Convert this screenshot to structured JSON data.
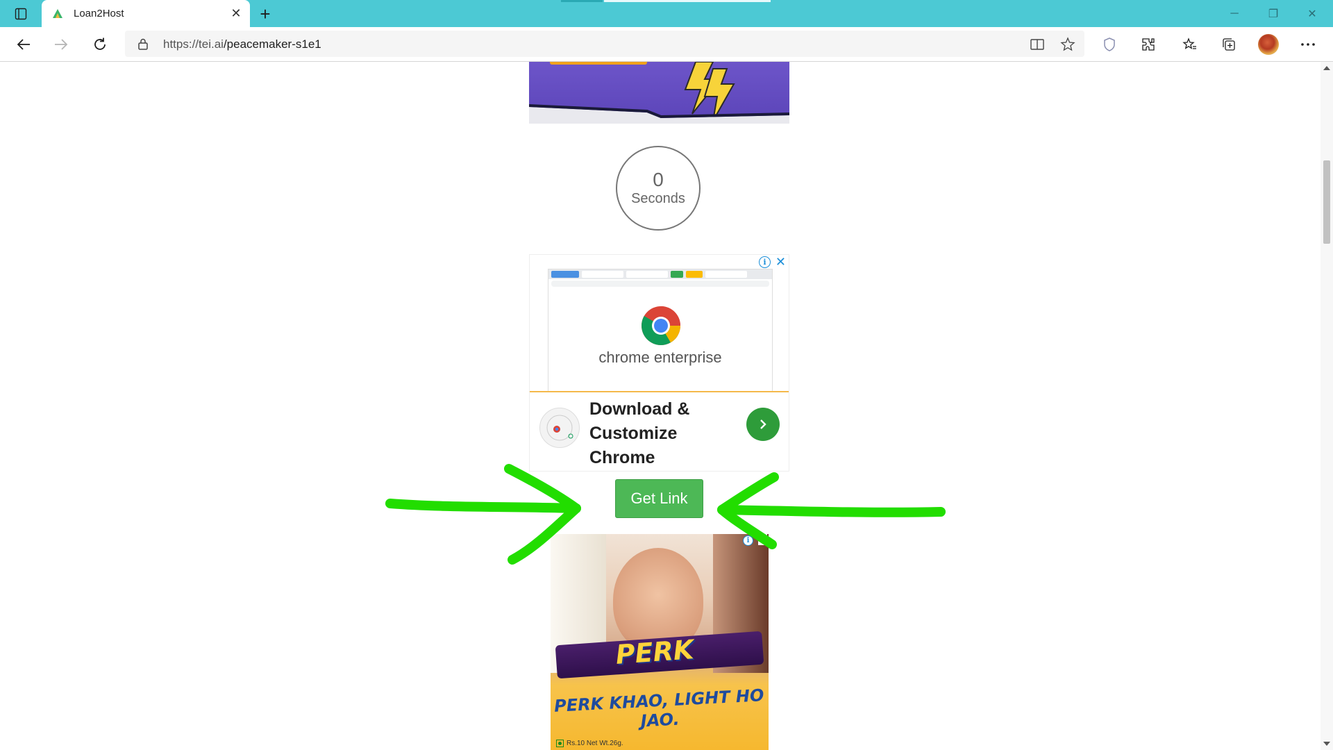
{
  "browser": {
    "tab": {
      "title": "Loan2Host"
    },
    "address": {
      "scheme_host": "https://tei.ai",
      "path": "/peacemaker-s1e1"
    },
    "accent": "#4cc9d4"
  },
  "page": {
    "timer": {
      "value": "0",
      "label": "Seconds"
    },
    "chrome_ad": {
      "brand": "chrome enterprise",
      "cta_line1": "Download &",
      "cta_line2": "Customize",
      "cta_line3": "Chrome"
    },
    "get_link": {
      "label": "Get Link",
      "color": "#4db856"
    },
    "perk_ad": {
      "logo": "PERK",
      "tagline": "PERK KHAO, LIGHT HO JAO.",
      "fine_print": "Rs.10 Net Wt.26g."
    },
    "annotation_arrows_color": "#22dd00"
  }
}
